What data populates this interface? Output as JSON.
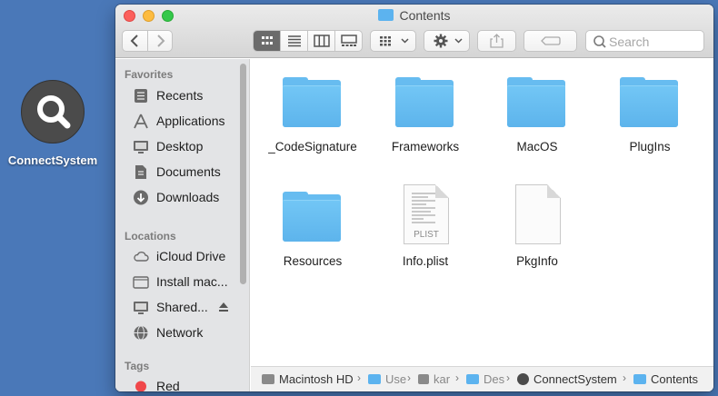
{
  "desktop": {
    "app_name": "ConnectSystem"
  },
  "window": {
    "title": "Contents"
  },
  "toolbar": {
    "view_modes": [
      "icon-view",
      "list-view",
      "column-view",
      "gallery-view"
    ],
    "active_view": "icon-view",
    "search_placeholder": "Search"
  },
  "sidebar": {
    "favorites_heading": "Favorites",
    "favorites": [
      {
        "label": "Recents",
        "icon": "clock-icon"
      },
      {
        "label": "Applications",
        "icon": "applications-icon"
      },
      {
        "label": "Desktop",
        "icon": "desktop-icon"
      },
      {
        "label": "Documents",
        "icon": "documents-icon"
      },
      {
        "label": "Downloads",
        "icon": "downloads-icon"
      }
    ],
    "locations_heading": "Locations",
    "locations": [
      {
        "label": "iCloud Drive",
        "icon": "cloud-icon"
      },
      {
        "label": "Install mac...",
        "icon": "disk-icon"
      },
      {
        "label": "Shared...",
        "icon": "display-icon"
      },
      {
        "label": "Network",
        "icon": "network-icon"
      }
    ],
    "tags_heading": "Tags",
    "tags": [
      {
        "label": "Red",
        "color": "#f0474a"
      }
    ]
  },
  "files": [
    {
      "name": "_CodeSignature",
      "kind": "folder"
    },
    {
      "name": "Frameworks",
      "kind": "folder"
    },
    {
      "name": "MacOS",
      "kind": "folder"
    },
    {
      "name": "PlugIns",
      "kind": "folder"
    },
    {
      "name": "Resources",
      "kind": "folder"
    },
    {
      "name": "Info.plist",
      "kind": "plist",
      "badge": "PLIST"
    },
    {
      "name": "PkgInfo",
      "kind": "document"
    }
  ],
  "pathbar": {
    "items": [
      {
        "label": "Macintosh HD",
        "icon": "hard-disk-icon"
      },
      {
        "label": "Use",
        "icon": "folder-icon"
      },
      {
        "label": "kar",
        "icon": "home-icon"
      },
      {
        "label": "Des",
        "icon": "folder-icon"
      },
      {
        "label": "ConnectSystem",
        "icon": "magnifier-app-icon"
      },
      {
        "label": "Contents",
        "icon": "folder-icon"
      }
    ]
  },
  "colors": {
    "desktop_bg": "#4a78b8",
    "folder_blue": "#67bcf0",
    "close": "#fc605c",
    "minimize": "#fdbc40",
    "zoom": "#34c84a"
  }
}
